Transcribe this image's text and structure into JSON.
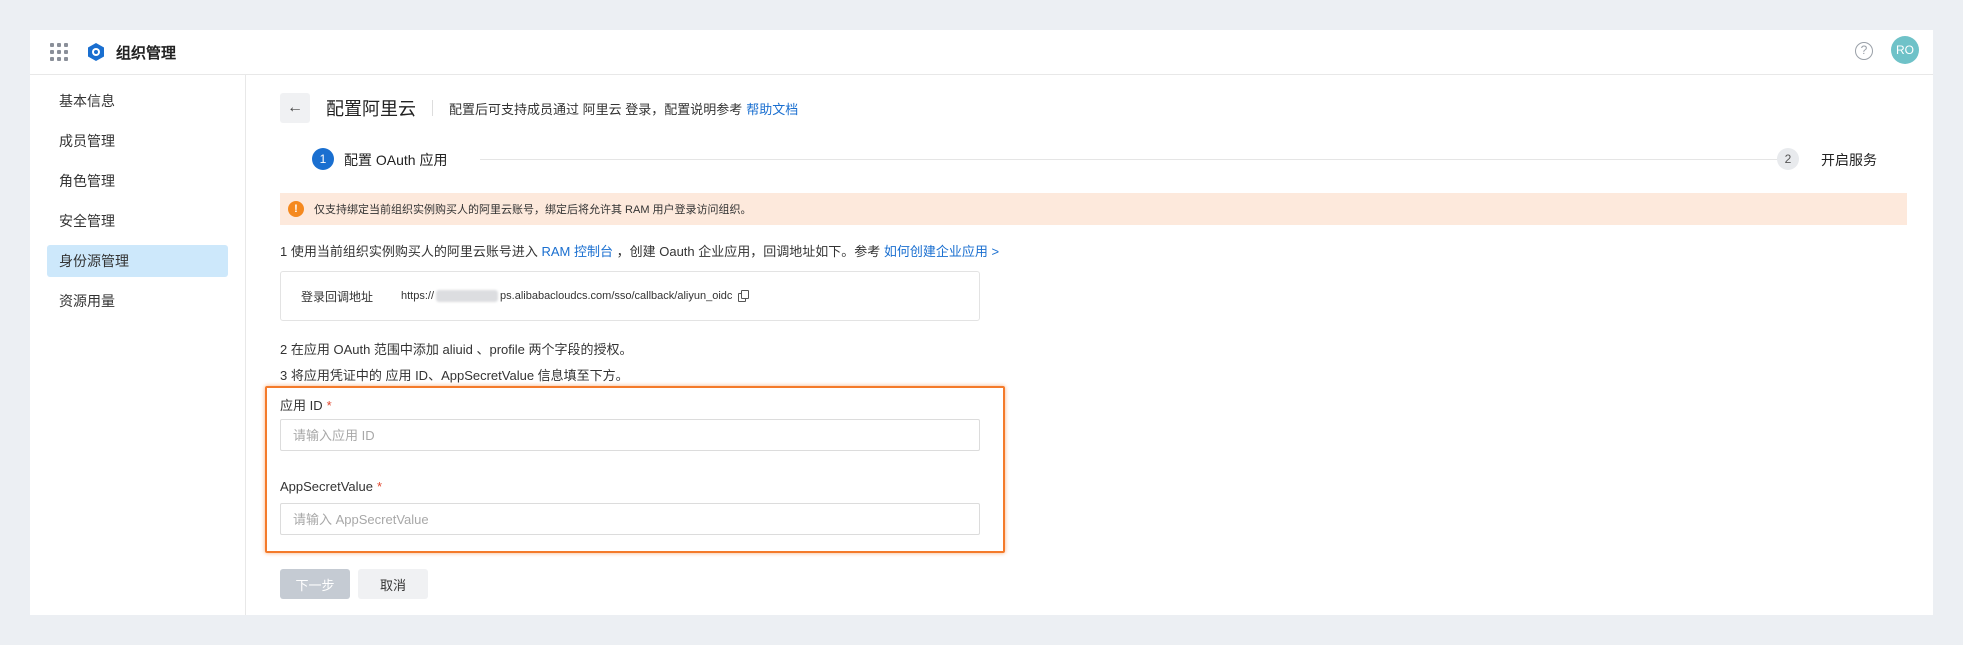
{
  "app": {
    "title": "组织管理",
    "avatar_initials": "RO",
    "help_glyph": "?"
  },
  "sidebar": {
    "items": [
      {
        "label": "基本信息"
      },
      {
        "label": "成员管理"
      },
      {
        "label": "角色管理"
      },
      {
        "label": "安全管理"
      },
      {
        "label": "身份源管理",
        "active": true
      },
      {
        "label": "资源用量"
      }
    ]
  },
  "page": {
    "back_glyph": "←",
    "title": "配置阿里云",
    "desc": "配置后可支持成员通过 阿里云 登录，配置说明参考",
    "desc_link": "帮助文档"
  },
  "steps": [
    {
      "number": "1",
      "label": "配置 OAuth 应用",
      "active": true
    },
    {
      "number": "2",
      "label": "开启服务",
      "active": false
    }
  ],
  "alert": {
    "icon": "!",
    "text": "仅支持绑定当前组织实例购买人的阿里云账号，绑定后将允许其 RAM 用户登录访问组织。"
  },
  "instructions": {
    "line1_prefix": "1 使用当前组织实例购买人的阿里云账号进入",
    "line1_link1": "RAM 控制台",
    "line1_mid": "，创建 Oauth 企业应用，回调地址如下。参考",
    "line1_link2": "如何创建企业应用 >",
    "line2": "2 在应用 OAuth 范围中添加 aliuid 、profile 两个字段的授权。",
    "line3": "3 将应用凭证中的 应用 ID、AppSecretValue 信息填至下方。"
  },
  "callback": {
    "label": "登录回调地址",
    "url_prefix": "https://",
    "url_suffix": "ps.alibabacloudcs.com/sso/callback/aliyun_oidc"
  },
  "form": {
    "app_id_label": "应用 ID",
    "app_id_placeholder": "请输入应用 ID",
    "app_id_value": "",
    "secret_label": "AppSecretValue",
    "secret_placeholder": "请输入 AppSecretValue",
    "secret_value": "",
    "required_mark": "*"
  },
  "buttons": {
    "next": "下一步",
    "cancel": "取消"
  },
  "colors": {
    "accent": "#1a6fd0",
    "highlight": "#f47a2a",
    "alert_bg": "#fde9dc",
    "alert_icon": "#f5891f"
  }
}
